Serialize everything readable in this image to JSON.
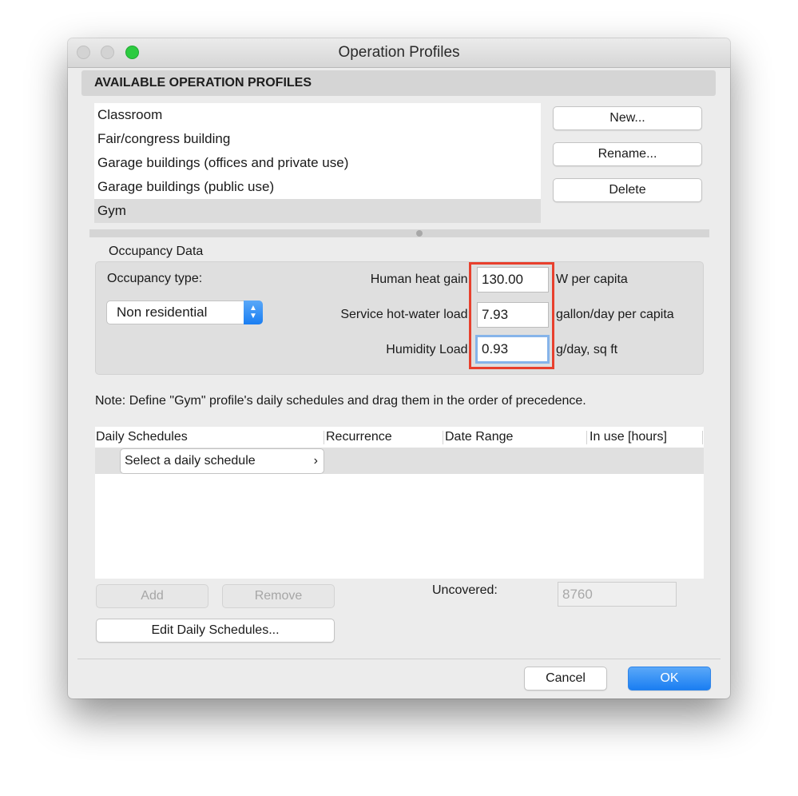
{
  "window": {
    "title": "Operation Profiles"
  },
  "profiles": {
    "header": "AVAILABLE OPERATION PROFILES",
    "items": [
      "Classroom",
      "Fair/congress building",
      "Garage buildings (offices and private use)",
      "Garage buildings (public use)",
      "Gym"
    ],
    "selected": "Gym",
    "buttons": {
      "new": "New...",
      "rename": "Rename...",
      "delete": "Delete"
    }
  },
  "occupancy": {
    "group_label": "Occupancy Data",
    "type_label": "Occupancy type:",
    "type_value": "Non residential",
    "human_heat_gain": {
      "label": "Human heat gain:",
      "value": "130.00",
      "unit": "W per capita"
    },
    "service_hot_water": {
      "label": "Service hot-water load:",
      "value": "7.93",
      "unit": "gallon/day per capita"
    },
    "humidity_load": {
      "label": "Humidity Load:",
      "value": "0.93",
      "unit": "g/day, sq ft"
    }
  },
  "note": "Note: Define \"Gym\" profile's daily schedules and drag them in the order of precedence.",
  "schedules": {
    "columns": [
      "Daily Schedules",
      "Recurrence",
      "Date Range",
      "In use [hours]"
    ],
    "select_placeholder": "Select a daily schedule",
    "add_label": "Add",
    "remove_label": "Remove",
    "edit_label": "Edit Daily Schedules...",
    "uncovered_label": "Uncovered:",
    "uncovered_value": "8760"
  },
  "footer": {
    "cancel": "Cancel",
    "ok": "OK"
  },
  "colors": {
    "accent": "#1a7ef2",
    "highlight": "#e8402d",
    "selection": "#dcdcdc"
  }
}
